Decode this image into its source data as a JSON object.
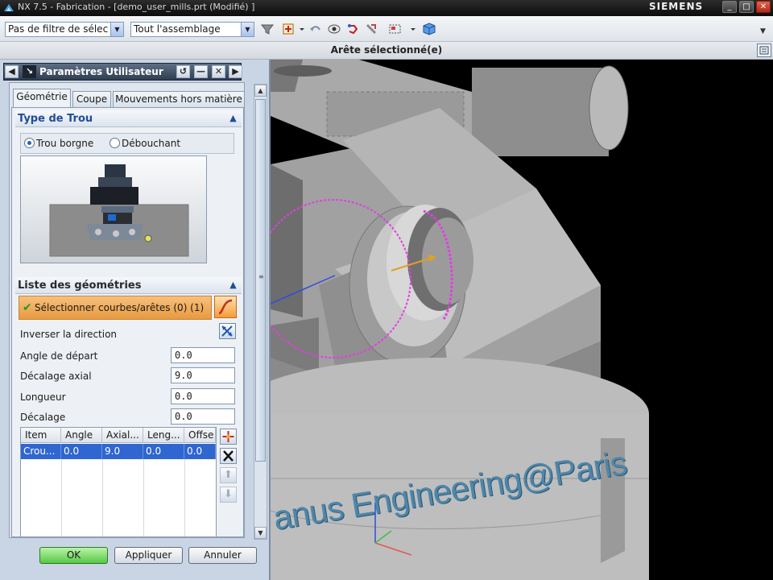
{
  "window": {
    "title": "NX 7.5 - Fabrication - [demo_user_mills.prt (Modifié) ]",
    "brand": "SIEMENS",
    "controls": {
      "minimize": "_",
      "maximize": "□",
      "close": "✕"
    }
  },
  "toolbar": {
    "filter_combo": "Pas de filtre de sélec",
    "assembly_combo": "Tout l'assemblage",
    "icons": [
      "funnel-icon",
      "snap-point-icon",
      "undo-icon",
      "view-icon",
      "rotate-icon",
      "pan-icon",
      "selection-box-icon",
      "cube-icon"
    ]
  },
  "cue_line": {
    "text": "Arête sélectionné(e)"
  },
  "panel": {
    "title": "Paramètres Utilisateur",
    "tabs": [
      "Géométrie",
      "Coupe",
      "Mouvements hors matière"
    ],
    "active_tab": "Géométrie",
    "hole_type": {
      "header": "Type de Trou",
      "options": [
        "Trou borgne",
        "Débouchant"
      ],
      "selected": "Trou borgne"
    },
    "geometry_list": {
      "header": "Liste des géométries",
      "select_label": "Sélectionner courbes/arêtes (0) (1)",
      "reverse_label": "Inverser la direction",
      "fields": [
        {
          "label": "Angle de départ",
          "value": "0.0"
        },
        {
          "label": "Décalage axial",
          "value": "9.0"
        },
        {
          "label": "Longueur",
          "value": "0.0"
        },
        {
          "label": "Décalage",
          "value": "0.0"
        }
      ],
      "table": {
        "columns": [
          "Item",
          "Angle",
          "Axial...",
          "Leng...",
          "Offse"
        ],
        "rows": [
          [
            "Crou...",
            "0.0",
            "9.0",
            "0.0",
            "0.0"
          ]
        ]
      }
    },
    "buttons": {
      "ok": "OK",
      "apply": "Appliquer",
      "cancel": "Annuler"
    }
  },
  "viewport": {
    "engraving_text": "anus Engineering@Paris",
    "background": "#000000"
  },
  "colors": {
    "titlebar": "#1a1a1a",
    "panel_bg": "#c9d5e4",
    "group_title": "#1f4e99",
    "selection_row": "#2f66d0",
    "select_highlight": "#f0a854",
    "ok_button": "#57c844",
    "edge_highlight": "#e23fe0"
  }
}
